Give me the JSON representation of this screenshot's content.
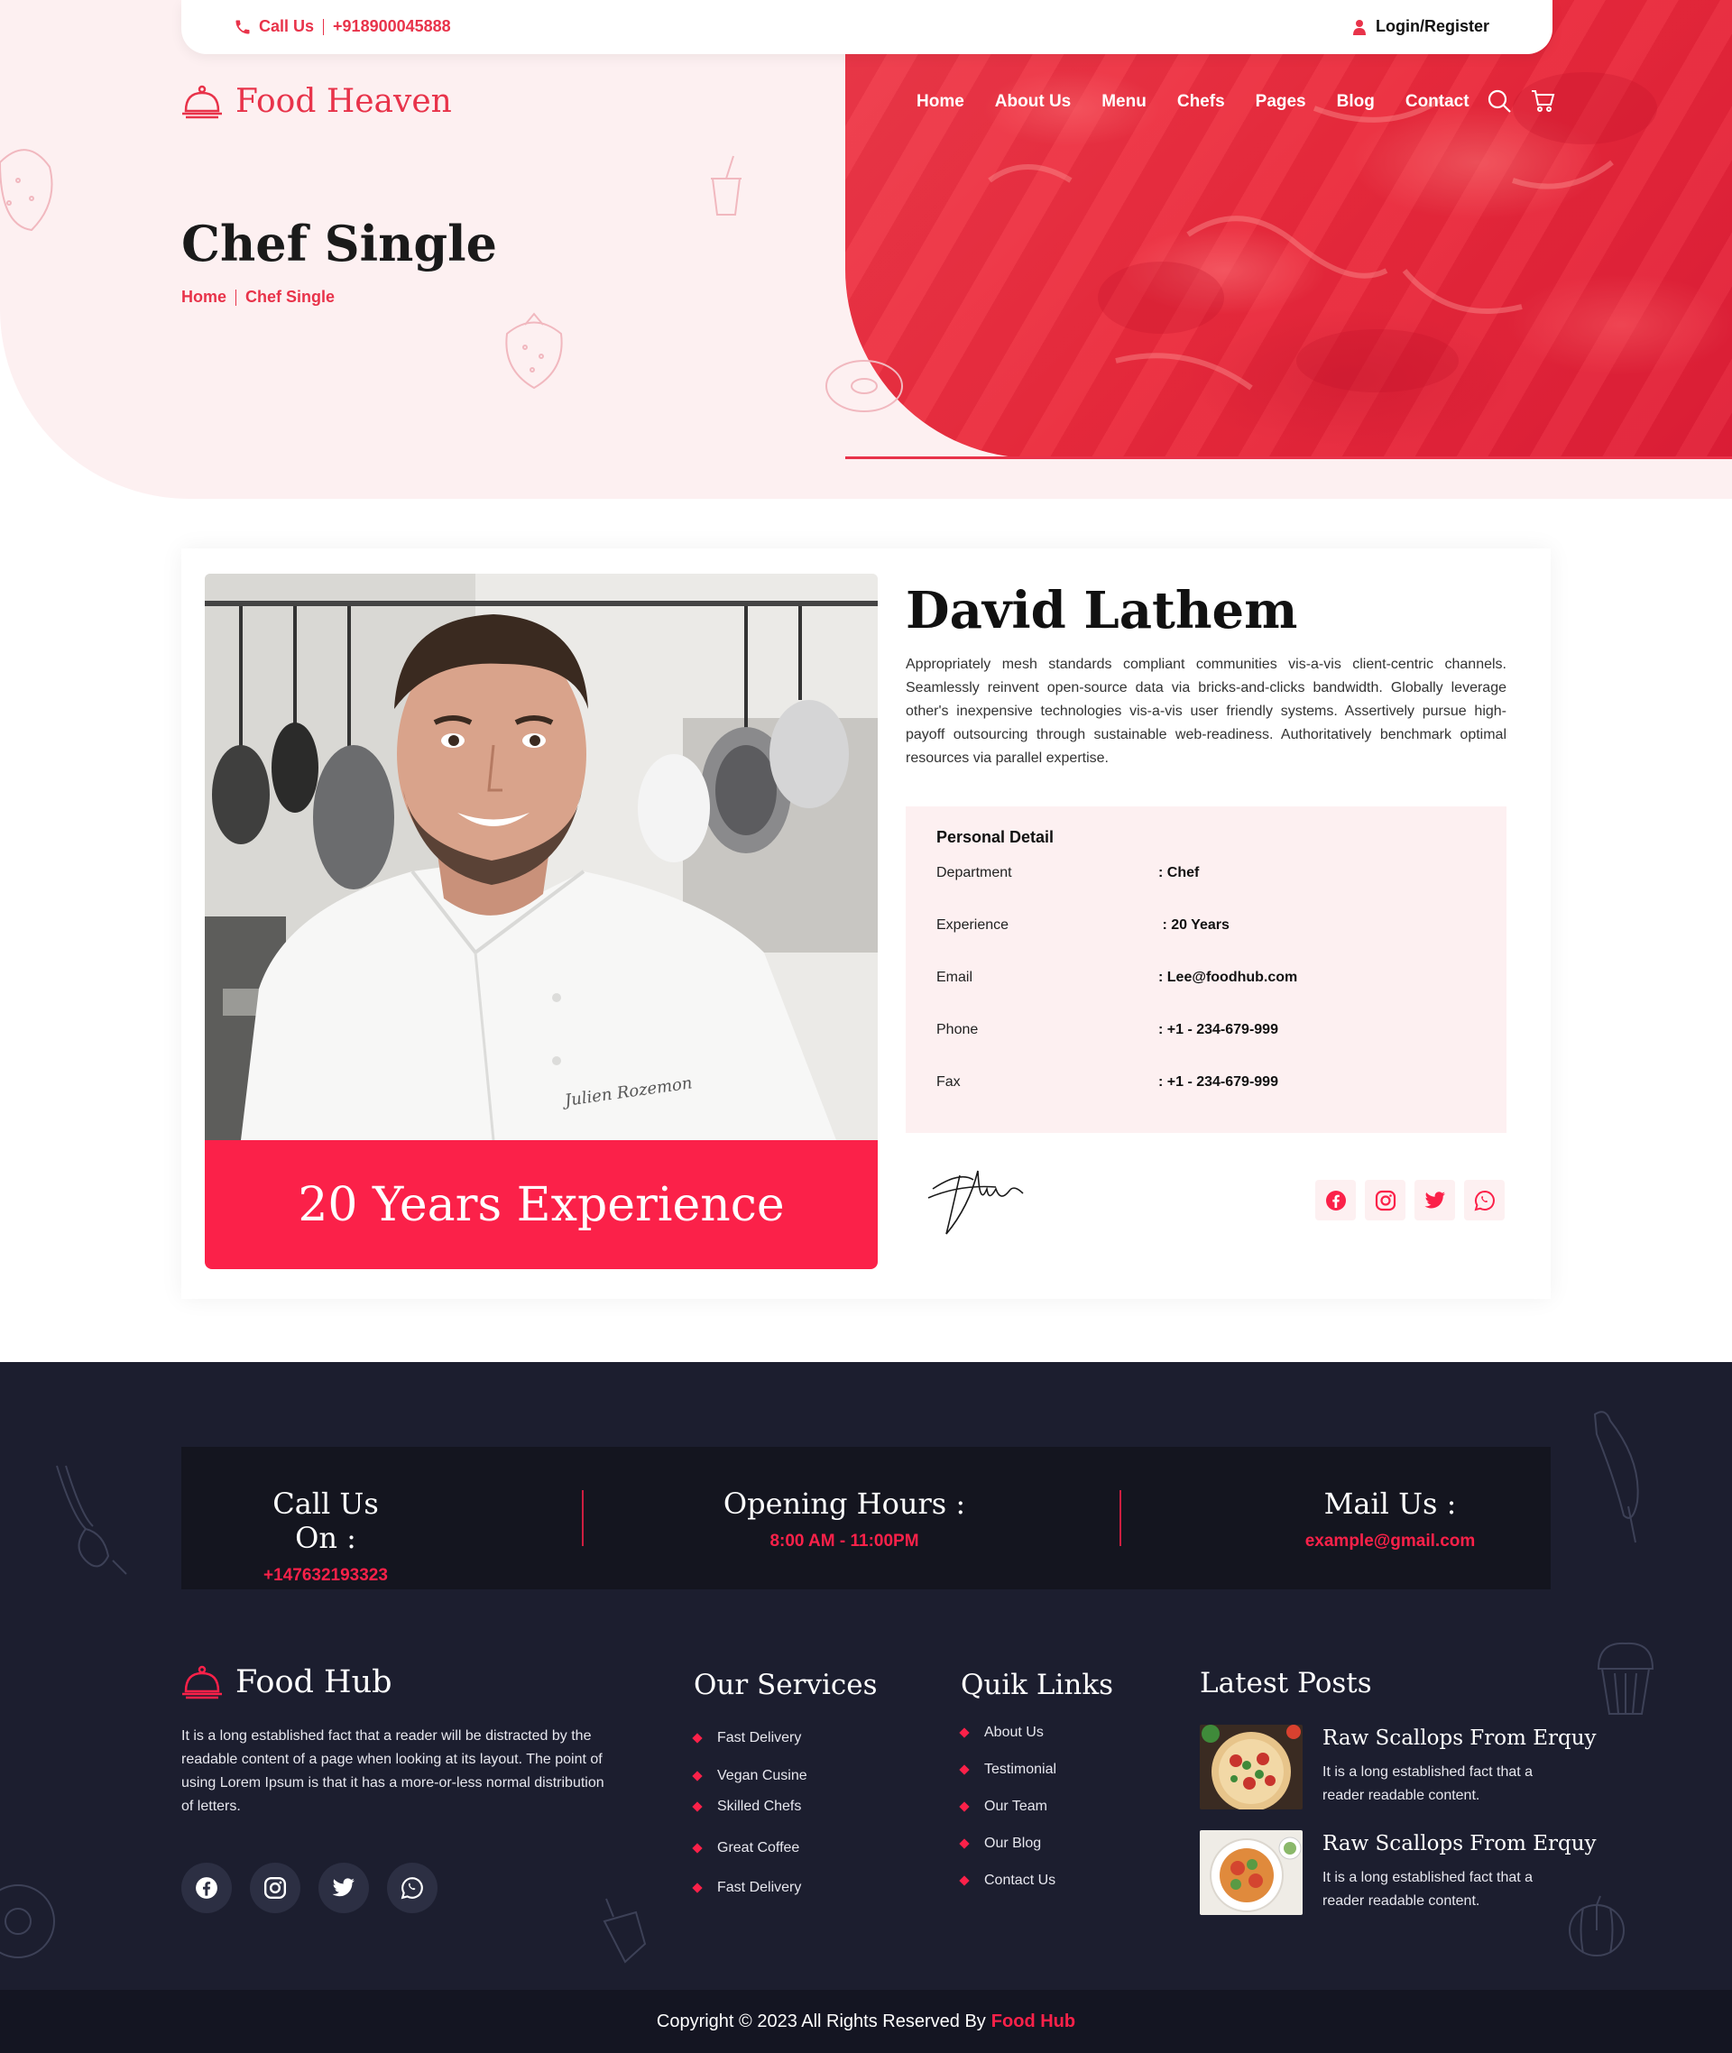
{
  "topbar": {
    "call_label": "Call Us",
    "phone": "+918900045888",
    "login_label": "Login/Register"
  },
  "brand": {
    "name": "Food Heaven"
  },
  "nav": {
    "items": [
      "Home",
      "About Us",
      "Menu",
      "Chefs",
      "Pages",
      "Blog",
      "Contact"
    ]
  },
  "hero": {
    "title": "Chef Single",
    "breadcrumb": [
      "Home",
      "Chef Single"
    ]
  },
  "chef": {
    "photo_caption": "Julien Rozemon",
    "experience_banner": "20 Years Experience",
    "name": "David Lathem",
    "bio": "Appropriately mesh standards compliant communities vis-a-vis client-centric channels. Seamlessly reinvent open-source data via bricks-and-clicks bandwidth. Globally leverage other's inexpensive technologies vis-a-vis user friendly systems. Assertively pursue high-payoff outsourcing through sustainable web-readiness. Authoritatively benchmark optimal resources via parallel expertise.",
    "details_title": "Personal Detail",
    "details": [
      {
        "label": "Department",
        "value": ": Chef"
      },
      {
        "label": "Experience",
        "value": " : 20 Years"
      },
      {
        "label": "Email",
        "value": ": Lee@foodhub.com"
      },
      {
        "label": "Phone",
        "value": ": +1 - 234-679-999"
      },
      {
        "label": "Fax",
        "value": ": +1 - 234-679-999"
      }
    ],
    "socials": [
      "facebook-icon",
      "instagram-icon",
      "twitter-icon",
      "whatsapp-icon"
    ]
  },
  "contact_band": {
    "call": {
      "title": "Call Us On :",
      "value": "+147632193323"
    },
    "hours": {
      "title": "Opening Hours :",
      "value": "8:00 AM - 11:00PM"
    },
    "mail": {
      "title": "Mail Us :",
      "value": "example@gmail.com"
    }
  },
  "footer": {
    "brand": "Food Hub",
    "about": "It is a long established fact that a reader will be distracted by the readable content of a page when looking at its layout. The point of using Lorem Ipsum is that it has a more-or-less normal distribution of letters.",
    "services_title": "Our Services",
    "services": [
      "Fast Delivery",
      "Vegan Cusine",
      "Skilled Chefs",
      "Great Coffee",
      "Fast Delivery"
    ],
    "links_title": "Quik Links",
    "links": [
      "About Us",
      "Testimonial",
      "Our Team",
      "Our Blog",
      "Contact Us"
    ],
    "posts_title": "Latest Posts",
    "posts": [
      {
        "title": "Raw Scallops From Erquy",
        "desc": "It is a long established fact that a reader readable content."
      },
      {
        "title": "Raw Scallops From Erquy",
        "desc": "It is a long established fact that a reader readable content."
      }
    ]
  },
  "copyright": {
    "text": "Copyright © 2023 All Rights Reserved By",
    "brand": "Food Hub"
  },
  "colors": {
    "accent": "#fb2149",
    "accent_text": "#e8334a",
    "hero_bg": "#fdf0f1",
    "footer_bg": "#1c1e2f",
    "band_bg": "#14151f"
  }
}
